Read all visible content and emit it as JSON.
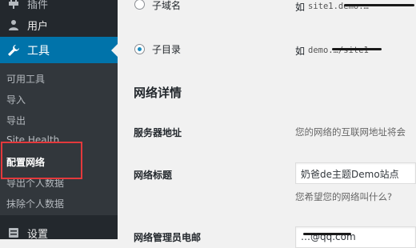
{
  "sidebar": {
    "plugins_label": "插件",
    "users_label": "用户",
    "tools_label": "工具",
    "settings_label": "设置",
    "submenu": [
      {
        "label": "可用工具"
      },
      {
        "label": "导入"
      },
      {
        "label": "导出"
      },
      {
        "label": "Site Health"
      },
      {
        "label": "配置网络"
      },
      {
        "label": "导出个人数据"
      },
      {
        "label": "抹除个人数据"
      }
    ],
    "highlight_color": "#e3393c",
    "active_color": "#0073aa"
  },
  "main": {
    "subdomain": {
      "label": "子域名",
      "example_prefix": "如",
      "example_text": "site1.demo.…",
      "checked": false
    },
    "subdirectory": {
      "label": "子目录",
      "example_prefix": "如",
      "example_text": "demo.…/site1",
      "checked": true
    },
    "section_title": "网络详情",
    "server_address": {
      "label": "服务器地址",
      "description": "您的网络的互联网地址将会"
    },
    "network_title": {
      "label": "网络标题",
      "value": "奶爸de主题Demo站点",
      "description": "您希望您的网络叫什么?"
    },
    "admin_email": {
      "label": "网络管理员电邮",
      "value": "…@qq.com"
    }
  }
}
